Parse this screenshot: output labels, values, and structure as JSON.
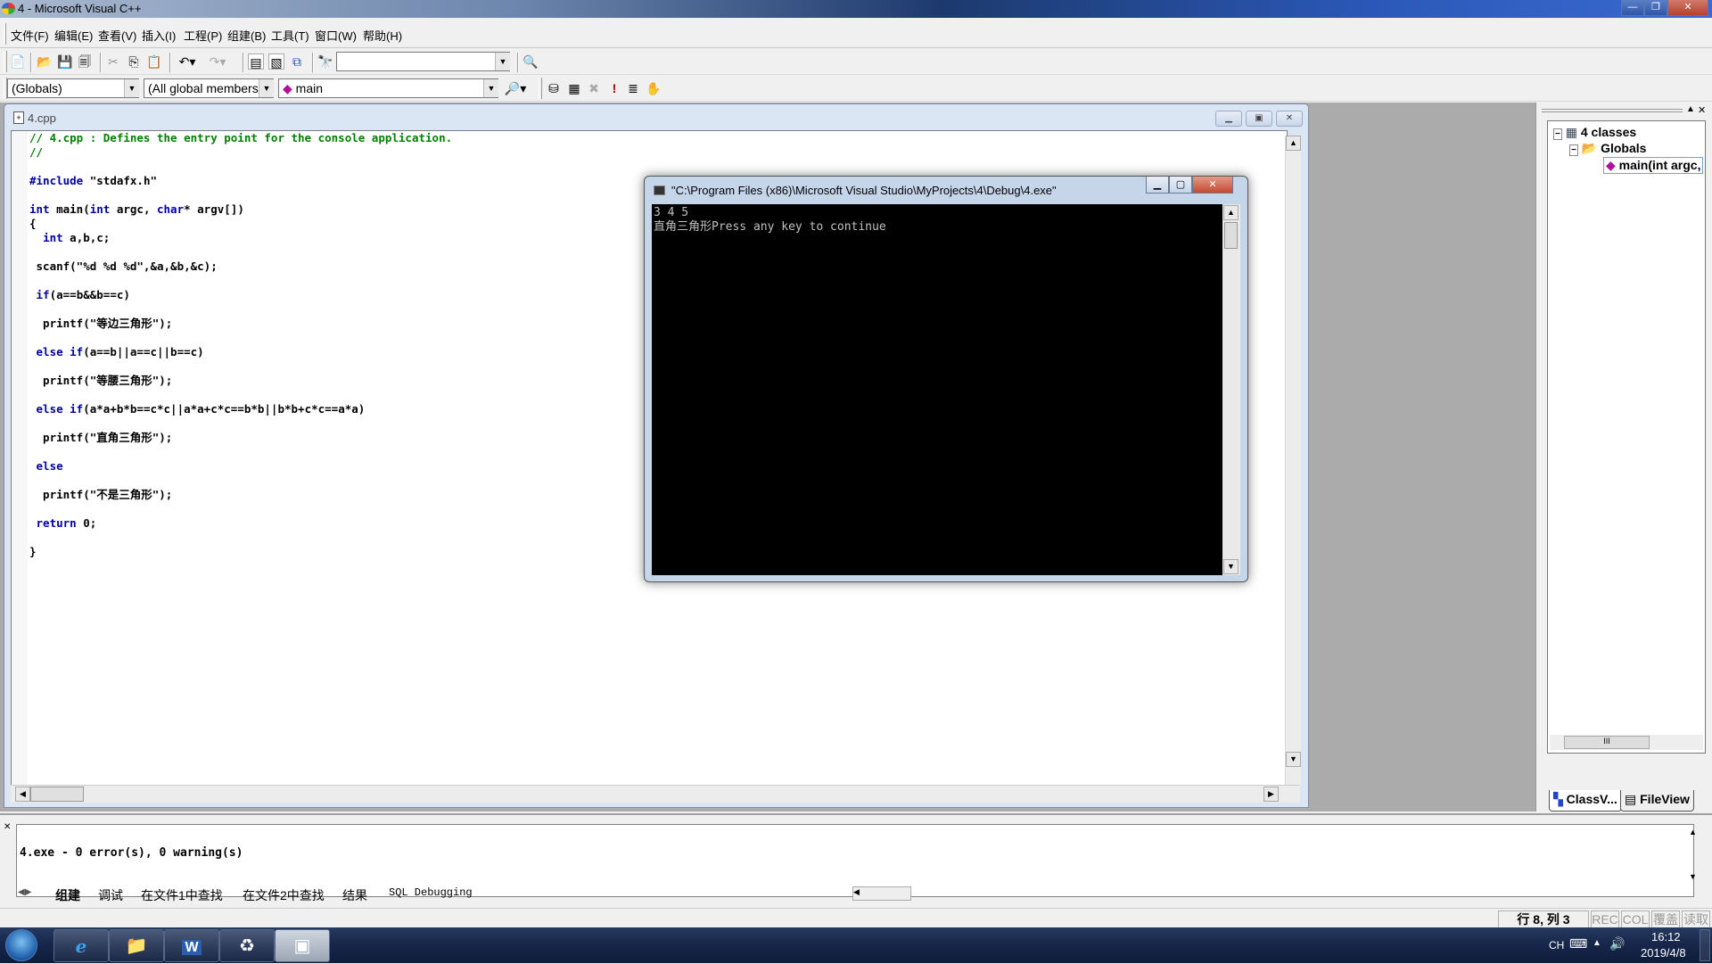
{
  "window": {
    "title": "4 - Microsoft Visual C++",
    "controls": {
      "minimize": "—",
      "restore": "❐",
      "close": "✕"
    }
  },
  "menubar": {
    "items": [
      "文件(F)",
      "编辑(E)",
      "查看(V)",
      "插入(I)",
      "工程(P)",
      "组建(B)",
      "工具(T)",
      "窗口(W)",
      "帮助(H)"
    ]
  },
  "toolbar1": {
    "icons": [
      "new-text-file-icon",
      "open-folder-icon",
      "save-icon",
      "save-all-icon",
      "cut-icon",
      "copy-icon",
      "paste-icon",
      "undo-icon",
      "redo-icon",
      "workspace-icon",
      "output-icon",
      "window-list-icon",
      "find-in-files-icon",
      "find-icon"
    ],
    "find_combo_value": ""
  },
  "toolbar2": {
    "class_combo": "(Globals)",
    "filter_combo": "(All global members",
    "member_combo": "main",
    "icons": [
      "wizard-action-icon",
      "compile-icon",
      "build-icon",
      "stop-build-icon",
      "execute-icon",
      "go-icon",
      "breakpoint-icon"
    ]
  },
  "editor": {
    "tab_title": "4.cpp",
    "lines": [
      [
        {
          "t": "// 4.cpp : Defines the entry point for the console application.",
          "c": "cm"
        }
      ],
      [
        {
          "t": "//",
          "c": "cm"
        }
      ],
      [
        {
          "t": "",
          "c": ""
        }
      ],
      [
        {
          "t": "#include",
          "c": "pp"
        },
        {
          "t": " \"stdafx.h\"",
          "c": ""
        }
      ],
      [
        {
          "t": "",
          "c": ""
        }
      ],
      [
        {
          "t": "int",
          "c": "kw"
        },
        {
          "t": " main(",
          "c": ""
        },
        {
          "t": "int",
          "c": "kw"
        },
        {
          "t": " argc, ",
          "c": ""
        },
        {
          "t": "char",
          "c": "kw"
        },
        {
          "t": "* argv[])",
          "c": ""
        }
      ],
      [
        {
          "t": "{",
          "c": ""
        }
      ],
      [
        {
          "t": "  ",
          "c": ""
        },
        {
          "t": "int",
          "c": "kw"
        },
        {
          "t": " a,b,c;",
          "c": ""
        }
      ],
      [
        {
          "t": "",
          "c": ""
        }
      ],
      [
        {
          "t": " scanf(\"%d %d %d\",&a,&b,&c);",
          "c": ""
        }
      ],
      [
        {
          "t": "",
          "c": ""
        }
      ],
      [
        {
          "t": " ",
          "c": ""
        },
        {
          "t": "if",
          "c": "kw"
        },
        {
          "t": "(a==b&&b==c)",
          "c": ""
        }
      ],
      [
        {
          "t": "",
          "c": ""
        }
      ],
      [
        {
          "t": "  printf(\"等边三角形\");",
          "c": ""
        }
      ],
      [
        {
          "t": "",
          "c": ""
        }
      ],
      [
        {
          "t": " ",
          "c": ""
        },
        {
          "t": "else if",
          "c": "kw"
        },
        {
          "t": "(a==b||a==c||b==c)",
          "c": ""
        }
      ],
      [
        {
          "t": "",
          "c": ""
        }
      ],
      [
        {
          "t": "  printf(\"等腰三角形\");",
          "c": ""
        }
      ],
      [
        {
          "t": "",
          "c": ""
        }
      ],
      [
        {
          "t": " ",
          "c": ""
        },
        {
          "t": "else if",
          "c": "kw"
        },
        {
          "t": "(a*a+b*b==c*c||a*a+c*c==b*b||b*b+c*c==a*a)",
          "c": ""
        }
      ],
      [
        {
          "t": "",
          "c": ""
        }
      ],
      [
        {
          "t": "  printf(\"直角三角形\");",
          "c": ""
        }
      ],
      [
        {
          "t": "",
          "c": ""
        }
      ],
      [
        {
          "t": " ",
          "c": ""
        },
        {
          "t": "else",
          "c": "kw"
        }
      ],
      [
        {
          "t": "",
          "c": ""
        }
      ],
      [
        {
          "t": "  printf(\"不是三角形\");",
          "c": ""
        }
      ],
      [
        {
          "t": "",
          "c": ""
        }
      ],
      [
        {
          "t": " ",
          "c": ""
        },
        {
          "t": "return",
          "c": "kw"
        },
        {
          "t": " 0;",
          "c": ""
        }
      ],
      [
        {
          "t": "",
          "c": ""
        }
      ],
      [
        {
          "t": "}",
          "c": ""
        }
      ]
    ]
  },
  "console": {
    "title": "\"C:\\Program Files (x86)\\Microsoft Visual Studio\\MyProjects\\4\\Debug\\4.exe\"",
    "output": "3 4 5\n直角三角形Press any key to continue"
  },
  "classview": {
    "root": "4 classes",
    "folder": "Globals",
    "item": "main(int argc,",
    "tabs": [
      "ClassV...",
      "FileView"
    ]
  },
  "output_panel": {
    "text": "4.exe - 0 error(s), 0 warning(s)",
    "tabs": [
      "组建",
      "调试",
      "在文件1中查找",
      "在文件2中查找",
      "结果",
      "SQL Debugging"
    ]
  },
  "statusbar": {
    "position": "行 8, 列 3",
    "indicators": [
      "REC",
      "COL",
      "覆盖",
      "读取"
    ]
  },
  "taskbar": {
    "apps": [
      "internet-explorer",
      "file-explorer",
      "word",
      "visual-cpp",
      "console"
    ],
    "language": "CH",
    "time": "16:12",
    "date": "2019/4/8"
  }
}
